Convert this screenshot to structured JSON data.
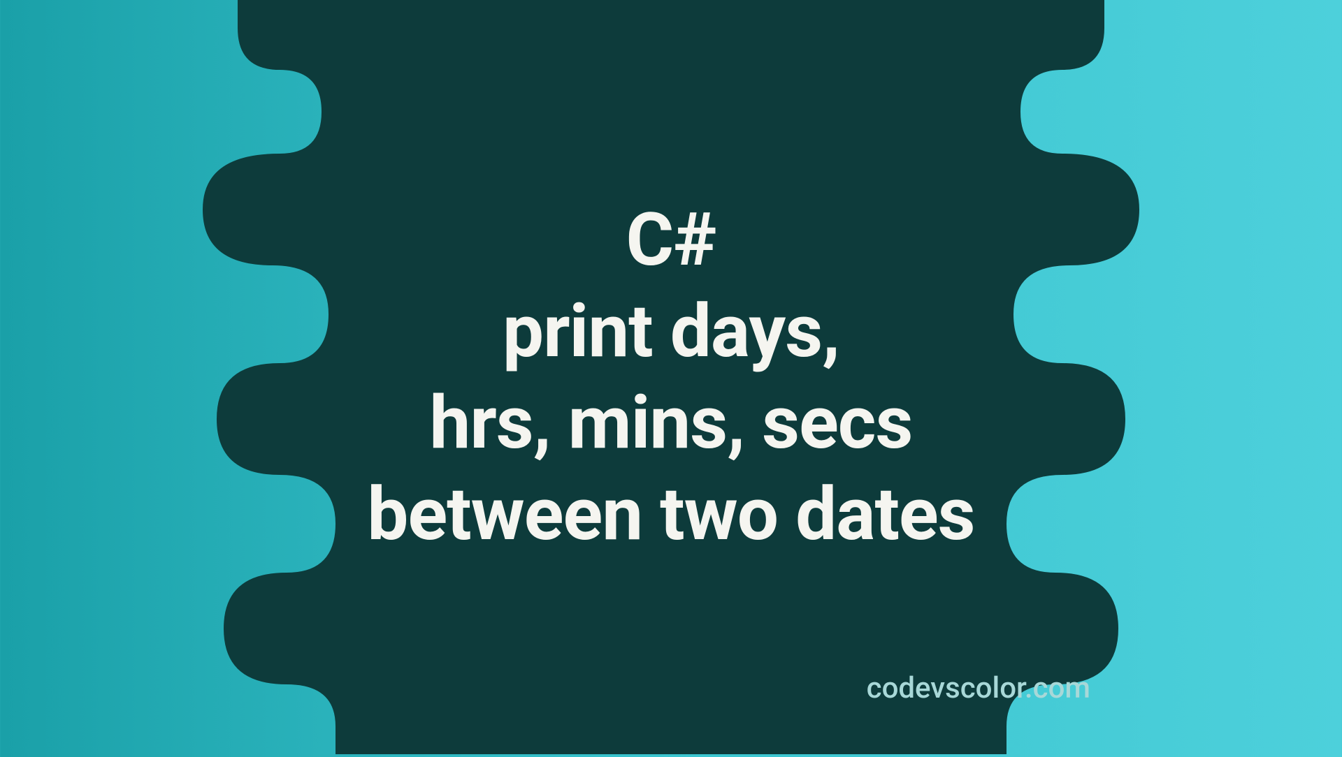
{
  "title": {
    "line1": "C#",
    "line2": "print days,",
    "line3": "hrs, mins, secs",
    "line4": "between two dates"
  },
  "watermark": "codevscolor.com",
  "colors": {
    "blob": "#0d3b3b",
    "text": "#f5f5f0",
    "watermark_text": "#a8d8d8",
    "bg_gradient_start": "#1aa0a8",
    "bg_gradient_end": "#4dd0db"
  }
}
